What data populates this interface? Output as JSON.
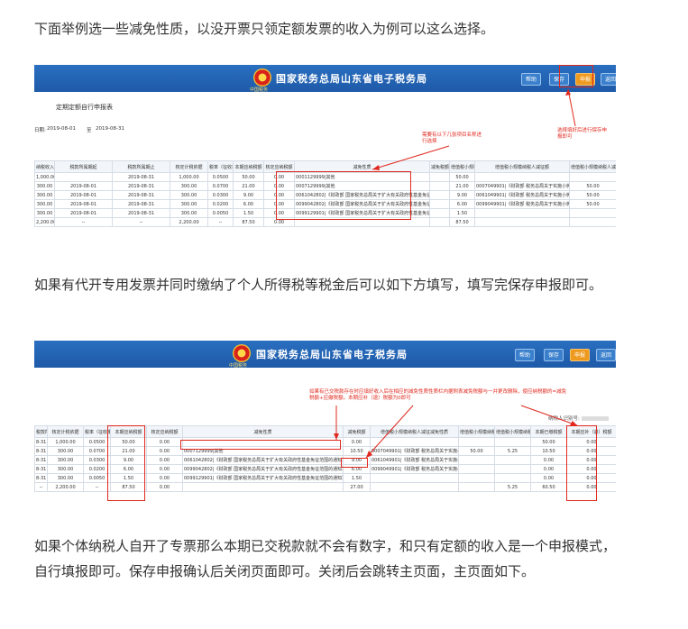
{
  "paragraphs": {
    "p1": "下面举例选一些减免性质，以没开票只领定额发票的收入为例可以这么选择。",
    "p2": "如果有代开专用发票并同时缴纳了个人所得税等税金后可以如下方填写，填写完保存申报即可。",
    "p3": "如果个体纳税人自开了专票那么本期已交税款就不会有数字，和只有定额的收入是一个申报模式，自行填报即可。保存申报确认后关闭页面即可。关闭后会跳转主页面，主页面如下。"
  },
  "portal": {
    "title": "国家税务总局山东省电子税务局",
    "emblem_text": "中国税务",
    "buttons": [
      "帮助",
      "保存",
      "申报",
      "返回"
    ]
  },
  "shot1": {
    "form_title": "定期定额自行申报表",
    "period_label": "日期:",
    "period_start": "2019-08-01",
    "period_to": "至",
    "period_end": "2019-08-31",
    "note_top": "需要有以下几张项目名称进行选择",
    "note_right": "选择填好后进行保存申报即可",
    "columns": [
      "纳税收入",
      "税款所属期起",
      "税款所属期止",
      "核定计税依据",
      "税率（征收率）",
      "本期应纳税额",
      "核定应纳税额",
      "减免性质",
      "减免税额",
      "增值税小规模纳税人减征减免税额",
      "增值税小规模纳税人减征额",
      "增值税小规模纳税人减征比例%"
    ],
    "rows": [
      [
        "1,000.00",
        "",
        "2019-08-31",
        "1,000.00",
        "0.0500",
        "50.00",
        "0.00",
        "0001129999|其他",
        "",
        "50.00",
        "",
        ""
      ],
      [
        "300.00",
        "2019-08-01",
        "2019-08-31",
        "300.00",
        "0.0700",
        "21.00",
        "0.00",
        "0007129999|其他",
        "",
        "21.00",
        "0007049901|《财政部 税务总局关于实施小微企业普惠性税收减免政策的通知》",
        "50.00"
      ],
      [
        "300.00",
        "2019-08-01",
        "2019-08-31",
        "300.00",
        "0.0300",
        "9.00",
        "0.00",
        "0061042802|《财政部 国家税务总局关于扩大有关政府性基金免征范围的通知》",
        "",
        "9.00",
        "0061049901|《财政部 税务总局关于实施小微企业普惠性税收减免政策的通知》",
        "50.00"
      ],
      [
        "300.00",
        "2019-08-01",
        "2019-08-31",
        "300.00",
        "0.0200",
        "6.00",
        "0.00",
        "0099042802|《财政部 国家税务总局关于扩大有关政府性基金免征范围的通知》",
        "",
        "6.00",
        "0099049901|《财政部 税务总局关于实施小微企业普惠性税收减免政策的通知》",
        "50.00"
      ],
      [
        "300.00",
        "2019-08-01",
        "2019-08-31",
        "300.00",
        "0.0050",
        "1.50",
        "0.00",
        "0099129901|《财政部 国家税务总局关于扩大有关政府性基金免征范围的通知》",
        "",
        "1.50",
        "",
        ""
      ],
      [
        "2,200.00",
        "--",
        "--",
        "2,200.00",
        "--",
        "87.50",
        "0.00",
        "",
        "",
        "87.50",
        "",
        ""
      ]
    ]
  },
  "shot2": {
    "note": "如果有已交税款存在时应填好收入后在相应的减免性质性质栏内据附表减免税额与一并更改删除，使应纳税额的=减免税额+应缴税额。本期应补（退）税额为0即可",
    "taxpayer_label": "纳税人识别号:",
    "columns": [
      "税款所属期止",
      "核定计税依据",
      "税率（征收率）",
      "本期应纳税额",
      "核定应纳税额",
      "减免性质",
      "减免税额",
      "增值税小规模纳税人减征减免性质",
      "增值税小规模纳税人减征额",
      "增值税小规模纳税人减征比例%",
      "本期已缴税额",
      "本期应补（退）税额"
    ],
    "rows": [
      [
        "8-31",
        "1,000.00",
        "0.0500",
        "50.00",
        "0.00",
        "",
        "0.00",
        "",
        "",
        "",
        "50.00",
        "0.00"
      ],
      [
        "8-31",
        "300.00",
        "0.0700",
        "21.00",
        "0.00",
        "0007129999|其他",
        "10.50",
        "0007049901|《财政部 税务总局关于实施小微企业普惠性税收减免政策的通知》",
        "50.00",
        "5.25",
        "10.50",
        "0.00"
      ],
      [
        "8-31",
        "300.00",
        "0.0300",
        "9.00",
        "0.00",
        "0061042802|《财政部 国家税务总局关于扩大有关政府性基金免征范围的通知》",
        "9.00",
        "0061049901|《财政部 税务总局关于实施小微企业普惠性税收减免政策的通知》",
        "",
        "",
        "0.00",
        "0.00"
      ],
      [
        "8-31",
        "300.00",
        "0.0200",
        "6.00",
        "0.00",
        "0099042802|《财政部 国家税务总局关于扩大有关政府性基金免征范围的通知》",
        "6.00",
        "0099049901|《财政部 税务总局关于实施小微企业普惠性税收减免政策的通知》",
        "",
        "",
        "0.00",
        "0.00"
      ],
      [
        "8-31",
        "300.00",
        "0.0050",
        "1.50",
        "0.00",
        "0099129901|《财政部 国家税务总局关于扩大有关政府性基金免征范围的通知》",
        "1.50",
        "",
        "",
        "",
        "0.00",
        "0.00"
      ],
      [
        "--",
        "2,200.00",
        "--",
        "87.50",
        "0.00",
        "",
        "27.00",
        "",
        "",
        "5.25",
        "60.50",
        "0.00"
      ]
    ]
  },
  "colors": {
    "banner": "#1e5aa8",
    "highlight": "#e0281e",
    "button_active": "#ee9a1e"
  }
}
